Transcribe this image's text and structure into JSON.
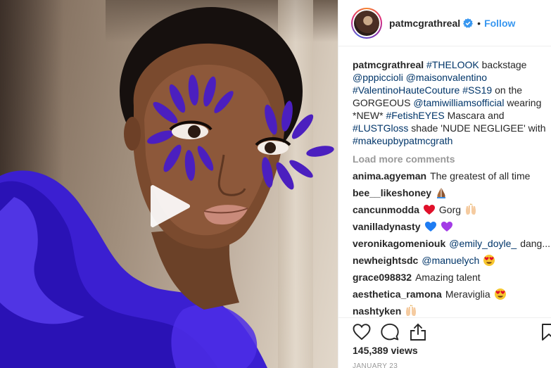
{
  "post": {
    "username": "patmcgrathreal",
    "follow_label": "Follow",
    "separator": "•"
  },
  "caption": {
    "username": "patmcgrathreal",
    "parts": [
      {
        "type": "tag",
        "text": "#THELOOK"
      },
      {
        "type": "plain",
        "text": " backstage "
      },
      {
        "type": "tag",
        "text": "@pppiccioli"
      },
      {
        "type": "plain",
        "text": " "
      },
      {
        "type": "tag",
        "text": "@maisonvalentino"
      },
      {
        "type": "plain",
        "text": " "
      },
      {
        "type": "tag",
        "text": "#ValentinoHauteCouture"
      },
      {
        "type": "plain",
        "text": " "
      },
      {
        "type": "tag",
        "text": "#SS19"
      },
      {
        "type": "plain",
        "text": " on the GORGEOUS "
      },
      {
        "type": "tag",
        "text": "@tamiwilliamsofficial"
      },
      {
        "type": "plain",
        "text": " wearing *NEW* "
      },
      {
        "type": "tag",
        "text": "#FetishEYES"
      },
      {
        "type": "plain",
        "text": " Mascara and "
      },
      {
        "type": "tag",
        "text": "#LUSTGloss"
      },
      {
        "type": "plain",
        "text": " shade 'NUDE NEGLIGEE' with "
      },
      {
        "type": "tag",
        "text": "#makeupbypatmcgrath"
      }
    ]
  },
  "load_more_label": "Load more comments",
  "comments": [
    {
      "username": "anima.agyeman",
      "text": "The greatest of all time",
      "mention": "",
      "emoji": [],
      "suffix": ""
    },
    {
      "username": "bee__likeshoney",
      "text": "",
      "mention": "",
      "emoji": [
        "folded-hands-icon"
      ],
      "suffix": ""
    },
    {
      "username": "cancunmodda",
      "text": "",
      "mention": "",
      "emoji": [
        "red-heart-icon"
      ],
      "text_after": "Gorg",
      "emoji_after": [
        "raised-hands-icon"
      ],
      "suffix": ""
    },
    {
      "username": "vanilladynasty",
      "text": "",
      "mention": "",
      "emoji": [
        "blue-heart-icon",
        "purple-heart-icon"
      ],
      "suffix": ""
    },
    {
      "username": "veronikagomeniouk",
      "text": "",
      "mention": "@emily_doyle_",
      "emoji": [],
      "suffix": "dang..."
    },
    {
      "username": "newheightsdc",
      "text": "",
      "mention": "@manuelych",
      "emoji": [
        "heart-eyes-icon"
      ],
      "suffix": ""
    },
    {
      "username": "grace098832",
      "text": "Amazing talent",
      "mention": "",
      "emoji": [],
      "suffix": ""
    },
    {
      "username": "aesthetica_ramona",
      "text": "Meraviglia",
      "mention": "",
      "emoji": [
        "heart-eyes-icon"
      ],
      "suffix": ""
    },
    {
      "username": "nashtyken",
      "text": "",
      "mention": "",
      "emoji": [
        "raised-hands-icon"
      ],
      "suffix": ""
    }
  ],
  "views": "145,389 views",
  "date": "JANUARY 23",
  "icons": {
    "like": "heart-outline-icon",
    "comment": "speech-bubble-icon",
    "share": "share-icon",
    "save": "bookmark-icon",
    "play": "play-icon",
    "verified": "verified-badge-icon"
  },
  "colors": {
    "link": "#003569",
    "follow": "#3897f0",
    "muted": "#999999",
    "verified": "#3897f0"
  }
}
